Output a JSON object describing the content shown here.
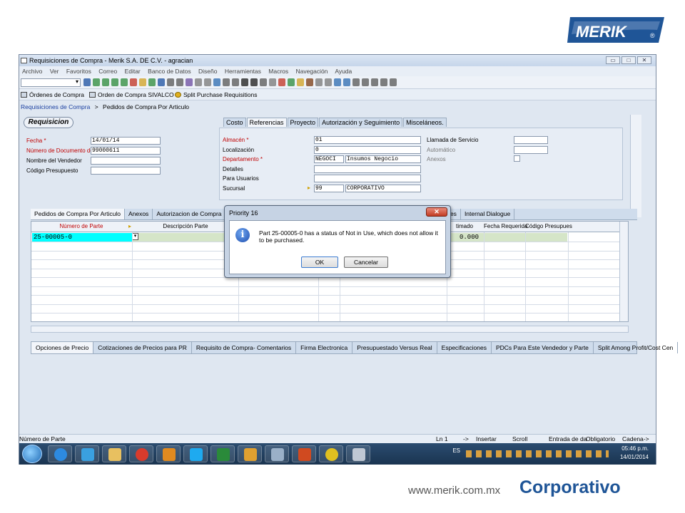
{
  "brand": {
    "logo_text": "MERIK",
    "registered": "®"
  },
  "window": {
    "title": "Requisiciones de Compra - Merik S.A. DE C.V. - agracian",
    "controls": [
      "▭",
      "□",
      "✕"
    ]
  },
  "menu": [
    "Archivo",
    "Ver",
    "Favoritos",
    "Correo",
    "Editar",
    "Banco de Datos",
    "Diseño",
    "Herramientas",
    "Macros",
    "Navegación",
    "Ayuda"
  ],
  "favorites": [
    "Órdenes de Compra",
    "Orden de Compra SIVALCO",
    "Split Purchase Requisitions"
  ],
  "breadcrumb": {
    "root": "Requisiciones de Compra",
    "sep": ">",
    "current": "Pedidos de Compra Por Articulo"
  },
  "form": {
    "section_title": "Requisicion",
    "fields": [
      {
        "label": "Fecha *",
        "value": "14/01/14",
        "required": true
      },
      {
        "label": "Número de Documento de D",
        "value": "99000611",
        "required": true
      },
      {
        "label": "Nombre del Vendedor",
        "value": "",
        "required": false
      },
      {
        "label": "Código Presupuesto",
        "value": "",
        "required": false
      }
    ]
  },
  "right_tabs": [
    "Costo",
    "Referencias",
    "Proyecto",
    "Autorización y Seguimiento",
    "Misceláneos."
  ],
  "referencias": {
    "left_fields": [
      {
        "label": "Almacén *",
        "value": "01",
        "value2": "",
        "required": true
      },
      {
        "label": "Localización",
        "value": "0",
        "value2": "",
        "required": false
      },
      {
        "label": "Departamento *",
        "value": "NEGOCI",
        "value2": "Insumos Negocio",
        "required": true
      },
      {
        "label": "Detalles",
        "value": "",
        "value2": "",
        "required": false
      },
      {
        "label": "Para Usuarios",
        "value": "",
        "value2": "",
        "required": false
      },
      {
        "label": "Sucursal",
        "value": "99",
        "value2": "CORPORATIVO",
        "required": false
      }
    ],
    "right_fields": [
      {
        "label": "Llamada de Servicio",
        "enabled": true
      },
      {
        "label": "Automático",
        "enabled": false
      },
      {
        "label": "Anexos",
        "enabled": false
      }
    ]
  },
  "line_tabs": [
    "Pedidos de Compra Por Articulo",
    "Anexos",
    "Autorizacion de Compra",
    "nges",
    "Internal Dialogue"
  ],
  "grid": {
    "columns": [
      "Número de Parte",
      "Descripción Parte",
      "timado",
      "Fecha Requerida",
      "Código Presupues"
    ],
    "rows": [
      {
        "part": "25-00005-0",
        "estimado": "0.000"
      }
    ]
  },
  "bottom_tabs": [
    "Opciones de Precio",
    "Cotizaciones de Precios para PR",
    "Requisito de Compra- Comentarios",
    "Firma Electronica",
    "Presupuestado Versus Real",
    "Especificaciones",
    "PDCs Para Este Vendedor y Parte",
    "Split Among Profit/Cost Cen"
  ],
  "status": {
    "field": "Número de Parte",
    "line": "Ln 1",
    "arrow": "->",
    "mode": "Insertar",
    "scroll": "Scroll",
    "entry": "Entrada de da",
    "required": "Obligatorio",
    "chain": "Cadena->"
  },
  "taskbar": {
    "lang": "ES",
    "time": "05:46 p.m.",
    "date": "14/01/2014"
  },
  "dialog": {
    "title": "Priority 16",
    "message": "Part 25-00005-0 has a status of Not in Use, which does not allow it to be purchased.",
    "ok": "OK",
    "cancel": "Cancelar"
  },
  "footer": {
    "url": "www.merik.com.mx",
    "label": "Corporativo"
  }
}
